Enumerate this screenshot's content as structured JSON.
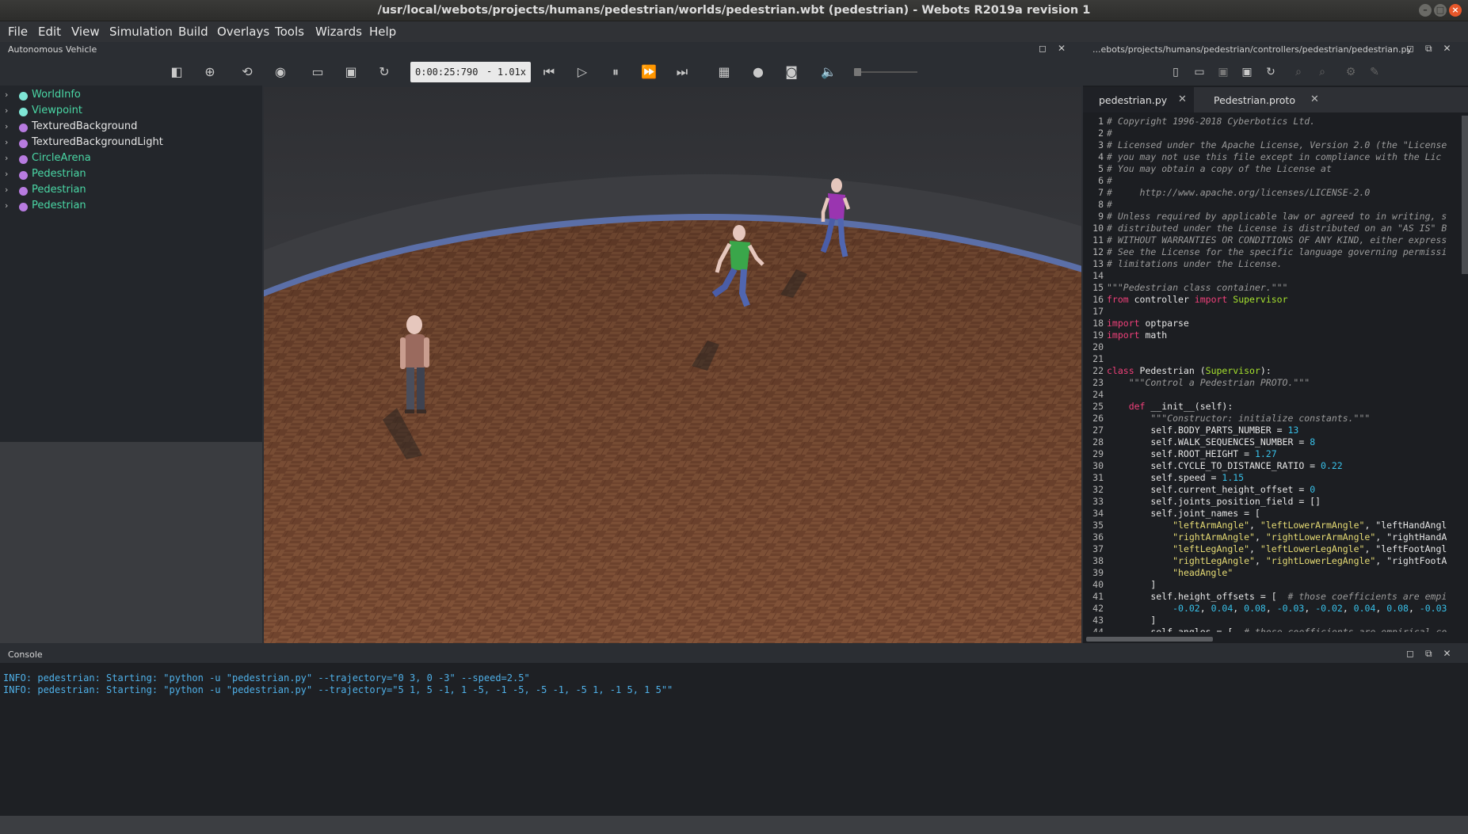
{
  "window": {
    "title": "/usr/local/webots/projects/humans/pedestrian/worlds/pedestrian.wbt (pedestrian) - Webots R2019a revision 1",
    "controls": [
      "–",
      "□",
      "×"
    ]
  },
  "menu": [
    "File",
    "Edit",
    "View",
    "Simulation",
    "Build",
    "Overlays",
    "Tools",
    "Wizards",
    "Help"
  ],
  "scene_panel": {
    "title": "Autonomous Vehicle",
    "items": [
      {
        "label": "WorldInfo",
        "color": "#4ad7a5",
        "dot": "#7fe6d6"
      },
      {
        "label": "Viewpoint",
        "color": "#4ad7a5",
        "dot": "#7fe6d6"
      },
      {
        "label": "TexturedBackground",
        "color": "#e6e6e6",
        "dot": "#b77be0"
      },
      {
        "label": "TexturedBackgroundLight",
        "color": "#e6e6e6",
        "dot": "#b77be0"
      },
      {
        "label": "CircleArena",
        "color": "#4ad7a5",
        "dot": "#b77be0"
      },
      {
        "label": "Pedestrian",
        "color": "#4ad7a5",
        "dot": "#b77be0"
      },
      {
        "label": "Pedestrian",
        "color": "#4ad7a5",
        "dot": "#b77be0"
      },
      {
        "label": "Pedestrian",
        "color": "#4ad7a5",
        "dot": "#b77be0"
      }
    ]
  },
  "toolbar": {
    "time": "0:00:25:790",
    "separator": "-",
    "speed": "1.01x",
    "volume": 0.0
  },
  "editor": {
    "path": "...ebots/projects/humans/pedestrian/controllers/pedestrian/pedestrian.py",
    "tabs": [
      "pedestrian.py",
      "Pedestrian.proto"
    ],
    "lines": [
      "# Copyright 1996-2018 Cyberbotics Ltd.",
      "#",
      "# Licensed under the Apache License, Version 2.0 (the \"License",
      "# you may not use this file except in compliance with the Lic",
      "# You may obtain a copy of the License at",
      "#",
      "#     http://www.apache.org/licenses/LICENSE-2.0",
      "#",
      "# Unless required by applicable law or agreed to in writing, s",
      "# distributed under the License is distributed on an \"AS IS\" B",
      "# WITHOUT WARRANTIES OR CONDITIONS OF ANY KIND, either express",
      "# See the License for the specific language governing permissi",
      "# limitations under the License.",
      "",
      "\"\"\"Pedestrian class container.\"\"\"",
      "from controller import Supervisor",
      "",
      "import optparse",
      "import math",
      "",
      "",
      "class Pedestrian (Supervisor):",
      "    \"\"\"Control a Pedestrian PROTO.\"\"\"",
      "",
      "    def __init__(self):",
      "        \"\"\"Constructor: initialize constants.\"\"\"",
      "        self.BODY_PARTS_NUMBER = 13",
      "        self.WALK_SEQUENCES_NUMBER = 8",
      "        self.ROOT_HEIGHT = 1.27",
      "        self.CYCLE_TO_DISTANCE_RATIO = 0.22",
      "        self.speed = 1.15",
      "        self.current_height_offset = 0",
      "        self.joints_position_field = []",
      "        self.joint_names = [",
      "            \"leftArmAngle\", \"leftLowerArmAngle\", \"leftHandAngl",
      "            \"rightArmAngle\", \"rightLowerArmAngle\", \"rightHandA",
      "            \"leftLegAngle\", \"leftLowerLegAngle\", \"leftFootAngl",
      "            \"rightLegAngle\", \"rightLowerLegAngle\", \"rightFootA",
      "            \"headAngle\"",
      "        ]",
      "        self.height_offsets = [  # those coefficients are empi",
      "            -0.02, 0.04, 0.08, -0.03, -0.02, 0.04, 0.08, -0.03",
      "        ]",
      "        self.angles = [  # those coefficients are empirical co"
    ]
  },
  "console": {
    "title": "Console",
    "lines": [
      "INFO: pedestrian: Starting: \"python -u \"pedestrian.py\" --trajectory=\"0 3, 0 -3\" --speed=2.5\"",
      "INFO: pedestrian: Starting: \"python -u \"pedestrian.py\" --trajectory=\"5 1, 5 -1, 1 -5, -1 -5, -5 -1, -5 1, -1 5, 1 5\"\""
    ]
  },
  "colors": {
    "comment": "#9a9a9a",
    "keyword": "#f0407a",
    "class_name": "#a6e22e",
    "number": "#38c0e8",
    "string": "#e6db74",
    "console_text": "#4fb0e8"
  },
  "icons": [
    "toggle-panel-icon",
    "add-node-icon",
    "reset-view-icon",
    "eye-icon",
    "open-folder-icon",
    "save-icon",
    "reload-icon",
    "step-back-icon",
    "play-icon",
    "pause-icon",
    "fast-forward-icon",
    "fastest-icon",
    "movie-icon",
    "record-icon",
    "camera-icon",
    "mute-icon",
    "new-file-icon",
    "open-file-icon",
    "save-file-icon",
    "save-all-icon",
    "revert-icon",
    "find-icon",
    "replace-icon",
    "build-icon",
    "clean-icon"
  ]
}
